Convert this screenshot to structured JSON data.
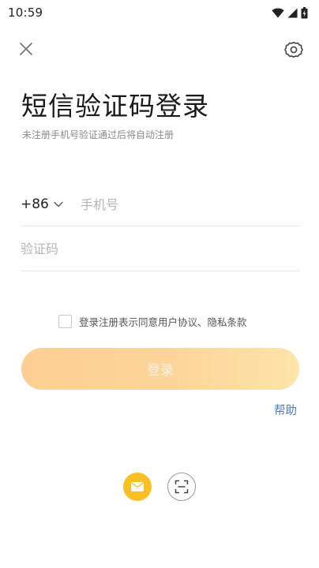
{
  "status_bar": {
    "time": "10:59",
    "icons": [
      "wifi-icon",
      "cellular-signal-icon",
      "battery-icon"
    ]
  },
  "nav": {
    "close_icon": "close-icon",
    "settings_icon": "gear-icon"
  },
  "header": {
    "title": "短信验证码登录",
    "subtitle": "未注册手机号验证通过后将自动注册"
  },
  "form": {
    "country_code": "+86",
    "phone_placeholder": "手机号",
    "phone_value": "",
    "code_placeholder": "验证码",
    "code_value": ""
  },
  "agreement": {
    "checked": false,
    "prefix": "登录注册表示同意",
    "user_agreement": "用户协议",
    "separator": "、",
    "privacy_policy": "隐私条款"
  },
  "login_button": {
    "label": "登录",
    "enabled": false
  },
  "help_label": "帮助",
  "alt_login": {
    "options": [
      "mail-icon",
      "scan-icon"
    ]
  },
  "colors": {
    "accent_gradient_start": "#fdcf92",
    "accent_gradient_end": "#fde4a8",
    "link": "#4b7fbd",
    "mail_button": "#f8c022"
  }
}
